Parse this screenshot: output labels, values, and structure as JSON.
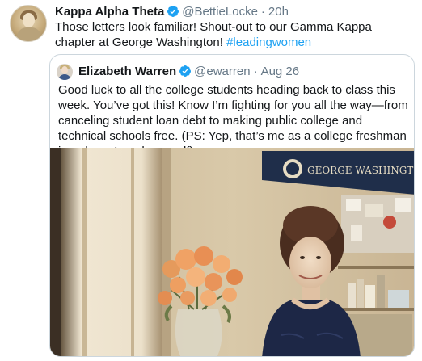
{
  "tweet": {
    "author_name": "Kappa Alpha Theta",
    "author_handle": "@BettieLocke",
    "separator": "·",
    "time": "20h",
    "text": "Those letters look familiar! Shout-out to our Gamma Kappa chapter at George Washington!",
    "hashtag": "#leadingwomen",
    "verified_icon": "verified-badge-icon"
  },
  "quoted_tweet": {
    "author_name": "Elizabeth Warren",
    "author_handle": "@ewarren",
    "separator": "·",
    "date": "Aug 26",
    "text": "Good luck to all the college students heading back to class this week. You’ve got this! Know I’m fighting for you all the way—from canceling student loan debt to making public college and technical schools free. (PS: Yep, that’s me as a college freshman in a dress I made myself).",
    "verified_icon": "verified-badge-icon",
    "photo": {
      "pennant_text": "GEORGE WASHINGTON"
    }
  },
  "colors": {
    "text": "#14171a",
    "secondary": "#657786",
    "link": "#1da1f2",
    "border": "#ccd6dd",
    "verified": "#1da1f2"
  }
}
